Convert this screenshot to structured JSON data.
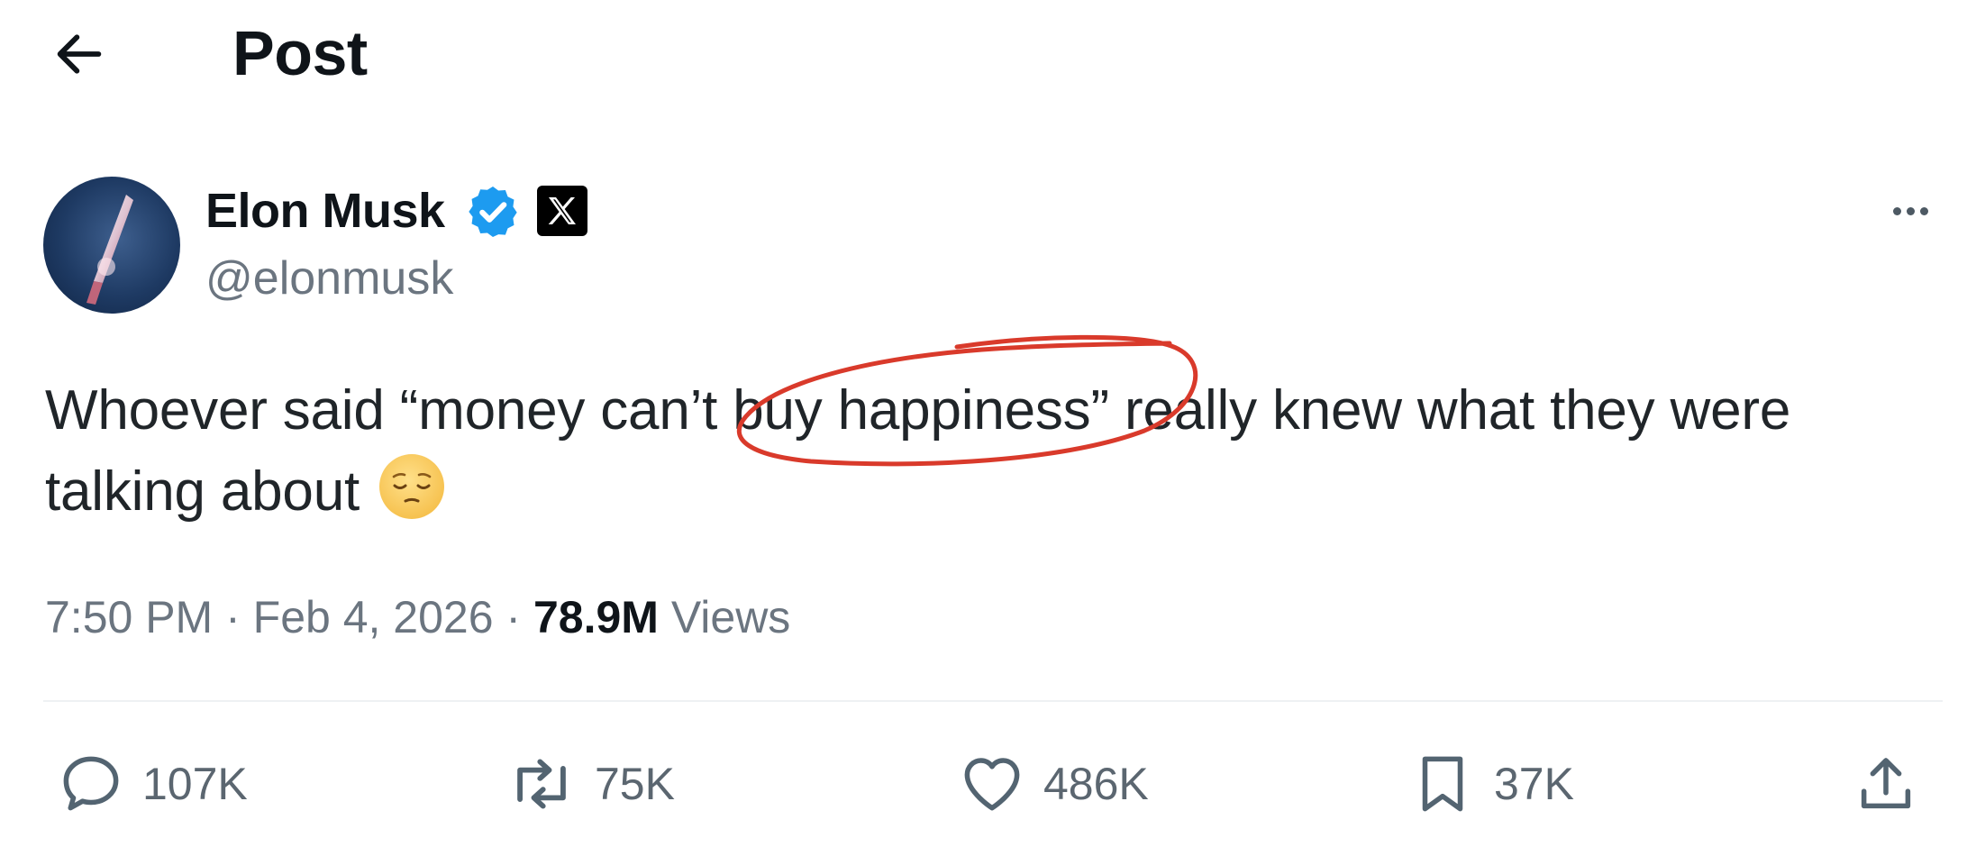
{
  "header": {
    "title": "Post"
  },
  "author": {
    "name": "Elon Musk",
    "handle": "@elonmusk",
    "verified": true
  },
  "post": {
    "line1_before": "Whoever said “money can’t ",
    "highlighted": "buy happiness”",
    "line1_after": " really knew what they were",
    "line2": "talking about",
    "emoji": "pensive-face"
  },
  "meta": {
    "time": "7:50 PM",
    "separator": " · ",
    "date": "Feb 4, 2026",
    "views_count": "78.9M",
    "views_label": " Views"
  },
  "actions": {
    "replies": "107K",
    "reposts": "75K",
    "likes": "486K",
    "bookmarks": "37K"
  },
  "colors": {
    "text": "#0f1419",
    "secondary": "#6b7580",
    "verified_blue": "#1d9bf0",
    "annotation_red": "#d93a2b"
  }
}
